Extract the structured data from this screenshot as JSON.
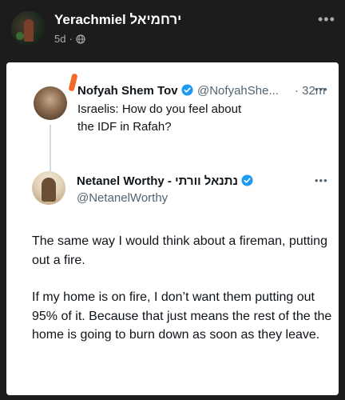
{
  "post": {
    "author_name": "Yerachmiel ירחמיאל",
    "age": "5d",
    "separator": "·",
    "more_label": "•••"
  },
  "embedded_thread": {
    "original_tweet": {
      "name": "Nofyah Shem Tov",
      "handle": "@NofyahShe...",
      "separator": "·",
      "time": "32m",
      "text": "Israelis: How do you feel about the IDF in Rafah?",
      "more_label": "•••"
    },
    "reply_tweet": {
      "name": "Netanel Worthy - נתנאל וורתי",
      "handle": "@NetanelWorthy",
      "more_label": "•••",
      "paragraph_1": "The same way I would think about a fireman, putting out a fire.",
      "paragraph_2": "If my home is on fire, I don’t want them putting out 95% of it. Because that just means the rest of the the home is going to burn down as soon as they leave."
    }
  },
  "colors": {
    "fb_background": "#1c1c1d",
    "verified_blue": "#1d9bf0",
    "highlight_orange": "#f26a26"
  },
  "icons": [
    "globe-icon",
    "verified-badge-icon",
    "more-options-icon"
  ]
}
